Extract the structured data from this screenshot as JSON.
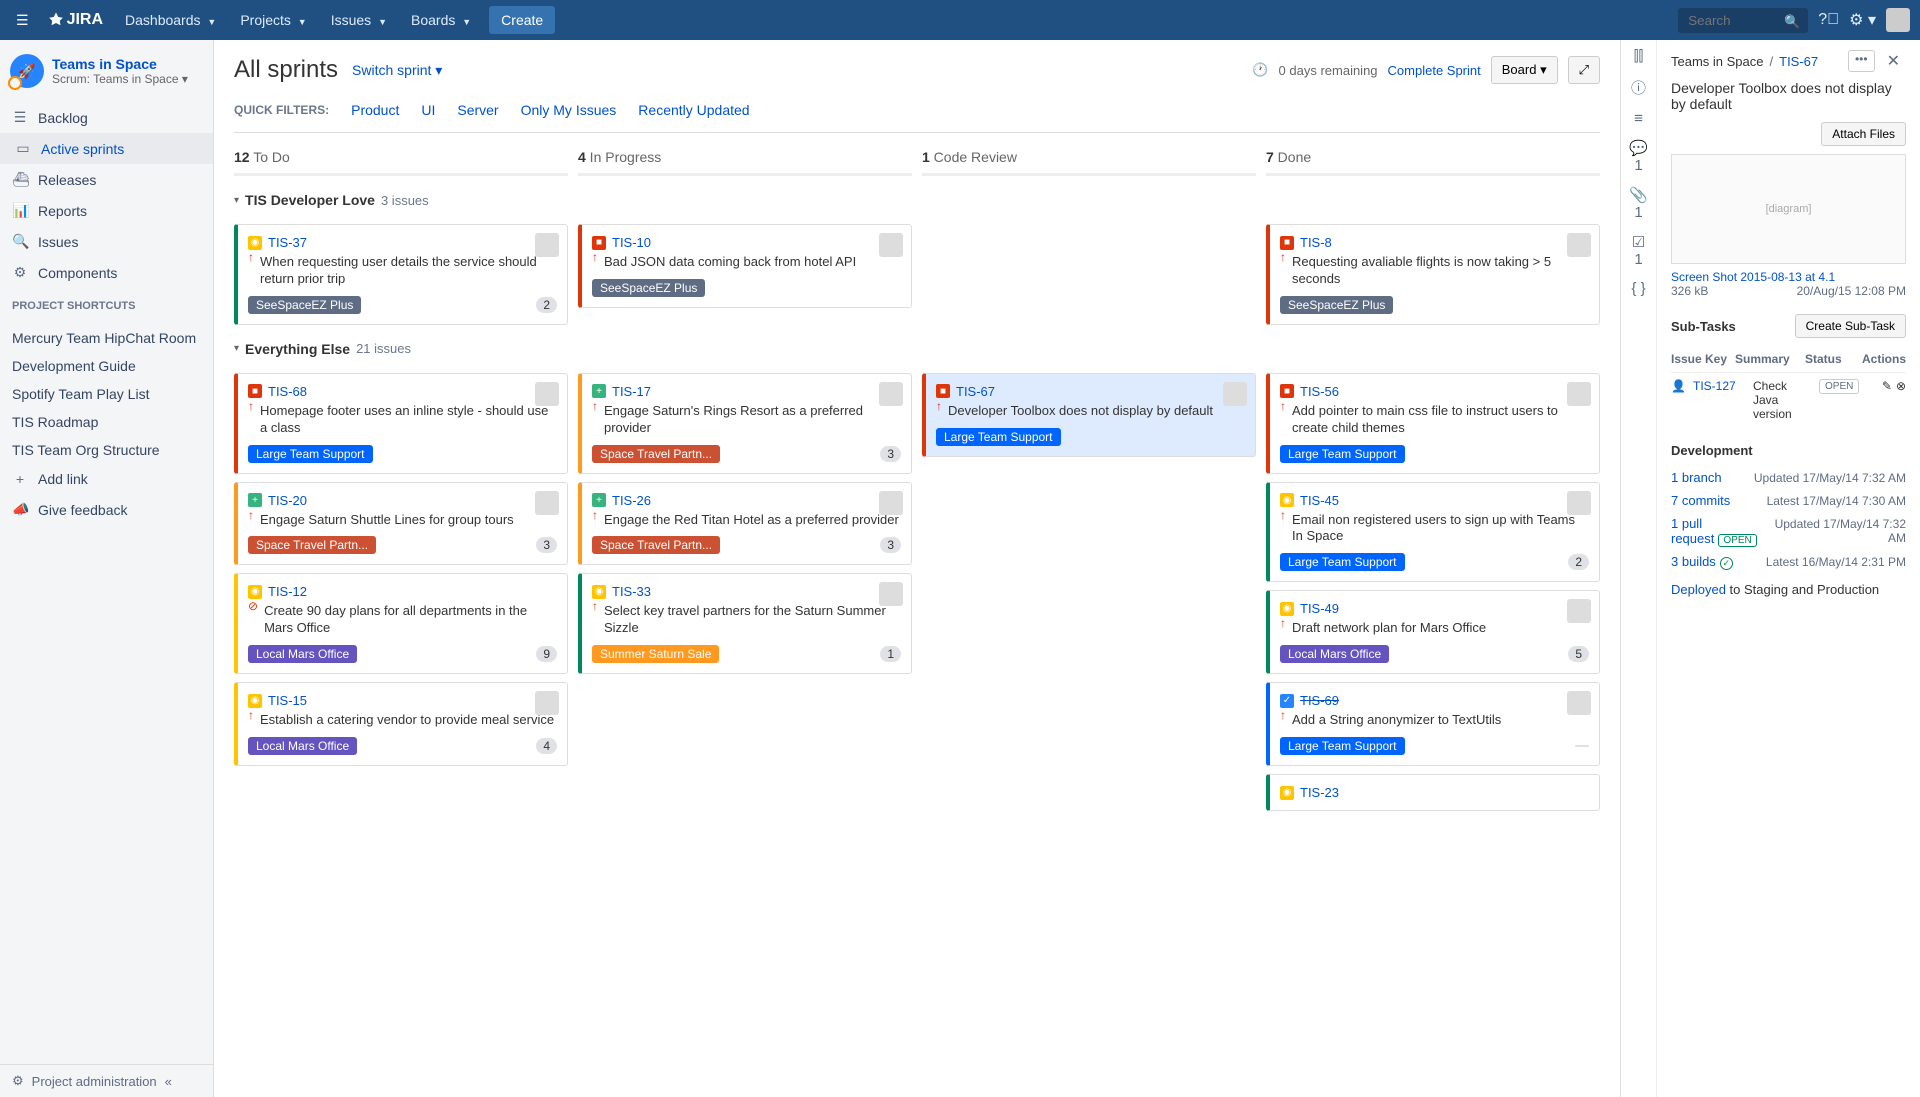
{
  "topbar": {
    "logo": "JIRA",
    "menus": [
      "Dashboards",
      "Projects",
      "Issues",
      "Boards"
    ],
    "create": "Create",
    "search_placeholder": "Search"
  },
  "project": {
    "name": "Teams in Space",
    "subtitle": "Scrum: Teams in Space"
  },
  "nav": [
    {
      "icon": "☰",
      "label": "Backlog"
    },
    {
      "icon": "▭",
      "label": "Active sprints",
      "active": true
    },
    {
      "icon": "⛴",
      "label": "Releases"
    },
    {
      "icon": "📊",
      "label": "Reports"
    },
    {
      "icon": "🔍",
      "label": "Issues"
    },
    {
      "icon": "⚙",
      "label": "Components"
    }
  ],
  "shortcuts_label": "PROJECT SHORTCUTS",
  "shortcuts": [
    "Mercury Team HipChat Room",
    "Development Guide",
    "Spotify Team Play List",
    "TIS Roadmap",
    "TIS Team Org Structure"
  ],
  "add_link": "Add link",
  "feedback": "Give feedback",
  "sb_footer": "Project administration",
  "header": {
    "title": "All sprints",
    "switch": "Switch sprint",
    "remaining": "0 days remaining",
    "complete": "Complete Sprint",
    "board_btn": "Board"
  },
  "filters_label": "QUICK FILTERS:",
  "filters": [
    "Product",
    "UI",
    "Server",
    "Only My Issues",
    "Recently Updated"
  ],
  "columns": [
    {
      "count": "12",
      "label": "To Do"
    },
    {
      "count": "4",
      "label": "In Progress"
    },
    {
      "count": "1",
      "label": "Code Review"
    },
    {
      "count": "7",
      "label": "Done"
    }
  ],
  "swimlanes": [
    {
      "name": "TIS Developer Love",
      "count": "3 issues",
      "cols": [
        [
          {
            "c": "green",
            "t": "imp",
            "k": "TIS-37",
            "p": "up",
            "s": "When requesting user details the service should return prior trip",
            "e": "SeeSpaceEZ Plus",
            "ec": "ep-see",
            "b": "2",
            "av": true
          }
        ],
        [
          {
            "c": "red",
            "t": "bug",
            "k": "TIS-10",
            "p": "up",
            "s": "Bad JSON data coming back from hotel API",
            "e": "SeeSpaceEZ Plus",
            "ec": "ep-see",
            "av": true
          }
        ],
        [],
        [
          {
            "c": "red",
            "t": "bug",
            "k": "TIS-8",
            "p": "up",
            "s": "Requesting avaliable flights is now taking > 5 seconds",
            "e": "SeeSpaceEZ Plus",
            "ec": "ep-see",
            "av": true
          }
        ]
      ]
    },
    {
      "name": "Everything Else",
      "count": "21 issues",
      "cols": [
        [
          {
            "c": "red",
            "t": "bug",
            "k": "TIS-68",
            "p": "up",
            "s": "Homepage footer uses an inline style - should use a class",
            "e": "Large Team Support",
            "ec": "ep-large",
            "av": true
          },
          {
            "c": "orange",
            "t": "story",
            "k": "TIS-20",
            "p": "up",
            "s": "Engage Saturn Shuttle Lines for group tours",
            "e": "Space Travel Partn...",
            "ec": "ep-space",
            "b": "3",
            "av": true
          },
          {
            "c": "yellow",
            "t": "imp",
            "k": "TIS-12",
            "p": "no",
            "s": "Create 90 day plans for all departments in the Mars Office",
            "e": "Local Mars Office",
            "ec": "ep-local",
            "b": "9"
          },
          {
            "c": "yellow",
            "t": "imp",
            "k": "TIS-15",
            "p": "up",
            "s": "Establish a catering vendor to provide meal service",
            "e": "Local Mars Office",
            "ec": "ep-local",
            "b": "4",
            "av": true
          }
        ],
        [
          {
            "c": "orange",
            "t": "story",
            "k": "TIS-17",
            "p": "up",
            "s": "Engage Saturn's Rings Resort as a preferred provider",
            "e": "Space Travel Partn...",
            "ec": "ep-space",
            "b": "3",
            "av": true
          },
          {
            "c": "orange",
            "t": "story",
            "k": "TIS-26",
            "p": "up",
            "s": "Engage the Red Titan Hotel as a preferred provider",
            "e": "Space Travel Partn...",
            "ec": "ep-space",
            "b": "3",
            "av": true
          },
          {
            "c": "green",
            "t": "imp",
            "k": "TIS-33",
            "p": "up",
            "s": "Select key travel partners for the Saturn Summer Sizzle",
            "e": "Summer Saturn Sale",
            "ec": "ep-summer",
            "b": "1",
            "av": true
          }
        ],
        [
          {
            "c": "red",
            "t": "bug",
            "k": "TIS-67",
            "p": "up",
            "s": "Developer Toolbox does not display by default",
            "e": "Large Team Support",
            "ec": "ep-large",
            "sel": true,
            "av": true
          }
        ],
        [
          {
            "c": "red",
            "t": "bug",
            "k": "TIS-56",
            "p": "up",
            "s": "Add pointer to main css file to instruct users to create child themes",
            "e": "Large Team Support",
            "ec": "ep-large",
            "av": true
          },
          {
            "c": "green",
            "t": "imp",
            "k": "TIS-45",
            "p": "up",
            "s": "Email non registered users to sign up with Teams In Space",
            "e": "Large Team Support",
            "ec": "ep-large",
            "b": "2",
            "av": true
          },
          {
            "c": "green",
            "t": "imp",
            "k": "TIS-49",
            "p": "up",
            "s": "Draft network plan for Mars Office",
            "e": "Local Mars Office",
            "ec": "ep-local",
            "b": "5",
            "av": true
          },
          {
            "c": "blue",
            "t": "task",
            "k": "TIS-69",
            "p": "up",
            "s": "Add a String anonymizer to TextUtils",
            "e": "Large Team Support",
            "ec": "ep-large",
            "b": " ",
            "strike": true,
            "av": true
          },
          {
            "c": "green",
            "t": "imp",
            "k": "TIS-23"
          }
        ]
      ]
    }
  ],
  "detail": {
    "proj": "Teams in Space",
    "key": "TIS-67",
    "title": "Developer Toolbox does not display by default",
    "attach_btn": "Attach Files",
    "file_name": "Screen Shot 2015-08-13 at 4.1",
    "file_size": "326 kB",
    "file_date": "20/Aug/15 12:08 PM",
    "subtasks_label": "Sub-Tasks",
    "create_subtask": "Create Sub-Task",
    "st_headers": [
      "Issue Key",
      "Summary",
      "Status",
      "Actions"
    ],
    "subtask": {
      "key": "TIS-127",
      "summary": "Check Java version",
      "status": "OPEN"
    },
    "dev_label": "Development",
    "dev_rows": [
      {
        "l": "1 branch",
        "r": "Updated 17/May/14 7:32 AM"
      },
      {
        "l": "7 commits",
        "r": "Latest 17/May/14 7:30 AM"
      },
      {
        "l": "1 pull request",
        "loz": "OPEN",
        "r": "Updated 17/May/14 7:32 AM"
      },
      {
        "l": "3 builds",
        "chk": true,
        "r": "Latest 16/May/14 2:31 PM"
      }
    ],
    "deployed": "Deployed",
    "deployed_to": " to Staging and Production",
    "tab_counts": {
      "comments": "1",
      "attach": "1",
      "tasks": "1"
    }
  }
}
